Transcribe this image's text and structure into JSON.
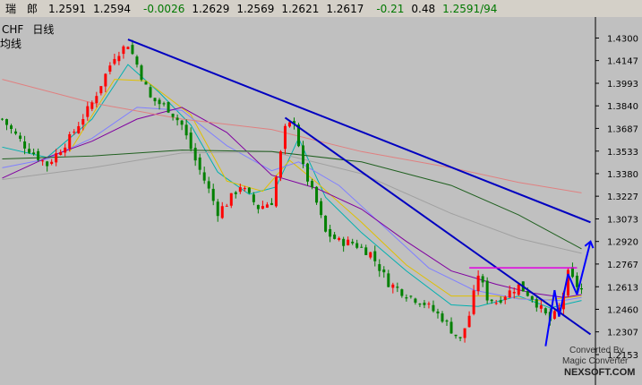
{
  "quote_bar": {
    "name": "瑞　郎",
    "bid": "1.2591",
    "ask": "1.2594",
    "change": "-0.0026",
    "high": "1.2629",
    "low": "1.2569",
    "open": "1.2621",
    "prev": "1.2617",
    "change_pct": "-0.21",
    "amplitude": "0.48",
    "last": "1.2591/94"
  },
  "chart_title": {
    "symbol": "CHF",
    "period": "日线",
    "indicator": "均线"
  },
  "watermark": {
    "line1": "Converted By",
    "line2": "Magic Converter",
    "line3": "NEXSOFT.COM"
  },
  "colors": {
    "background": "#c0c0c0",
    "candle_up": "#ff0000",
    "candle_down": "#008000",
    "ma_fast": "#00b0b0",
    "ma_short": "#e0c000",
    "ma_mid": "#8080ff",
    "ma_purple": "#8000a0",
    "ma_long": "#a0a0a0",
    "ma_dark": "#206020",
    "ma_pink": "#e08080",
    "trendline": "#0000c0",
    "resistance": "#e000e0",
    "arrow": "#0000ff"
  },
  "chart_data": {
    "type": "candlestick",
    "symbol": "CHF",
    "period": "daily",
    "ylim": [
      1.2153,
      1.44
    ],
    "y_ticks": [
      "1.4300",
      "1.4147",
      "1.3993",
      "1.3840",
      "1.3687",
      "1.3533",
      "1.3380",
      "1.3227",
      "1.3073",
      "1.2920",
      "1.2767",
      "1.2613",
      "1.2460",
      "1.2307",
      "1.2153"
    ],
    "bar_count": 130,
    "close_path": [
      [
        0,
        1.375
      ],
      [
        5,
        1.357
      ],
      [
        10,
        1.344
      ],
      [
        15,
        1.362
      ],
      [
        20,
        1.386
      ],
      [
        25,
        1.418
      ],
      [
        28,
        1.426
      ],
      [
        30,
        1.412
      ],
      [
        33,
        1.389
      ],
      [
        37,
        1.382
      ],
      [
        40,
        1.371
      ],
      [
        43,
        1.347
      ],
      [
        46,
        1.327
      ],
      [
        48,
        1.312
      ],
      [
        50,
        1.318
      ],
      [
        53,
        1.33
      ],
      [
        57,
        1.315
      ],
      [
        60,
        1.319
      ],
      [
        63,
        1.368
      ],
      [
        65,
        1.374
      ],
      [
        67,
        1.342
      ],
      [
        70,
        1.318
      ],
      [
        72,
        1.298
      ],
      [
        75,
        1.292
      ],
      [
        78,
        1.291
      ],
      [
        82,
        1.284
      ],
      [
        86,
        1.264
      ],
      [
        90,
        1.256
      ],
      [
        94,
        1.25
      ],
      [
        98,
        1.24
      ],
      [
        100,
        1.232
      ],
      [
        102,
        1.225
      ],
      [
        104,
        1.242
      ],
      [
        106,
        1.27
      ],
      [
        108,
        1.254
      ],
      [
        110,
        1.251
      ],
      [
        112,
        1.256
      ],
      [
        115,
        1.262
      ],
      [
        118,
        1.254
      ],
      [
        120,
        1.246
      ],
      [
        122,
        1.238
      ],
      [
        124,
        1.246
      ],
      [
        126,
        1.27
      ],
      [
        128,
        1.262
      ],
      [
        129,
        1.2591
      ]
    ],
    "moving_averages": [
      {
        "color": "ma_fast",
        "points": [
          [
            0,
            1.356
          ],
          [
            10,
            1.349
          ],
          [
            20,
            1.375
          ],
          [
            28,
            1.412
          ],
          [
            35,
            1.393
          ],
          [
            42,
            1.371
          ],
          [
            48,
            1.339
          ],
          [
            55,
            1.324
          ],
          [
            61,
            1.329
          ],
          [
            66,
            1.362
          ],
          [
            72,
            1.322
          ],
          [
            80,
            1.298
          ],
          [
            90,
            1.272
          ],
          [
            100,
            1.249
          ],
          [
            106,
            1.248
          ],
          [
            115,
            1.255
          ],
          [
            122,
            1.247
          ],
          [
            129,
            1.252
          ]
        ]
      },
      {
        "color": "ma_short",
        "points": [
          [
            15,
            1.353
          ],
          [
            25,
            1.402
          ],
          [
            32,
            1.401
          ],
          [
            42,
            1.378
          ],
          [
            50,
            1.333
          ],
          [
            58,
            1.326
          ],
          [
            64,
            1.347
          ],
          [
            70,
            1.332
          ],
          [
            80,
            1.305
          ],
          [
            90,
            1.276
          ],
          [
            100,
            1.255
          ],
          [
            110,
            1.255
          ],
          [
            120,
            1.252
          ],
          [
            129,
            1.255
          ]
        ]
      },
      {
        "color": "ma_mid",
        "points": [
          [
            0,
            1.342
          ],
          [
            10,
            1.348
          ],
          [
            20,
            1.362
          ],
          [
            30,
            1.383
          ],
          [
            40,
            1.381
          ],
          [
            50,
            1.357
          ],
          [
            60,
            1.34
          ],
          [
            66,
            1.346
          ],
          [
            75,
            1.33
          ],
          [
            85,
            1.302
          ],
          [
            95,
            1.274
          ],
          [
            105,
            1.259
          ],
          [
            115,
            1.253
          ],
          [
            125,
            1.252
          ],
          [
            129,
            1.254
          ]
        ]
      },
      {
        "color": "ma_purple",
        "points": [
          [
            0,
            1.335
          ],
          [
            10,
            1.349
          ],
          [
            20,
            1.36
          ],
          [
            30,
            1.375
          ],
          [
            40,
            1.383
          ],
          [
            50,
            1.366
          ],
          [
            60,
            1.337
          ],
          [
            70,
            1.328
          ],
          [
            80,
            1.314
          ],
          [
            90,
            1.292
          ],
          [
            100,
            1.272
          ],
          [
            110,
            1.263
          ],
          [
            118,
            1.257
          ],
          [
            125,
            1.254
          ],
          [
            129,
            1.256
          ]
        ]
      },
      {
        "color": "ma_long",
        "points": [
          [
            0,
            1.334
          ],
          [
            20,
            1.342
          ],
          [
            40,
            1.352
          ],
          [
            60,
            1.353
          ],
          [
            80,
            1.338
          ],
          [
            100,
            1.311
          ],
          [
            115,
            1.294
          ],
          [
            129,
            1.284
          ]
        ]
      },
      {
        "color": "ma_dark",
        "points": [
          [
            0,
            1.348
          ],
          [
            20,
            1.35
          ],
          [
            40,
            1.354
          ],
          [
            60,
            1.353
          ],
          [
            80,
            1.346
          ],
          [
            100,
            1.33
          ],
          [
            115,
            1.31
          ],
          [
            129,
            1.287
          ]
        ]
      },
      {
        "color": "ma_pink",
        "points": [
          [
            0,
            1.402
          ],
          [
            20,
            1.386
          ],
          [
            40,
            1.375
          ],
          [
            60,
            1.368
          ],
          [
            80,
            1.353
          ],
          [
            100,
            1.342
          ],
          [
            115,
            1.332
          ],
          [
            129,
            1.325
          ]
        ]
      }
    ],
    "trendlines": [
      {
        "color": "trendline",
        "from": [
          28,
          1.429
        ],
        "to": [
          131,
          1.305
        ]
      },
      {
        "color": "trendline",
        "from": [
          63,
          1.376
        ],
        "to": [
          131,
          1.229
        ]
      },
      {
        "color": "resistance",
        "from": [
          104,
          1.2741
        ],
        "to": [
          128,
          1.2741
        ]
      },
      {
        "color": "arrow",
        "from": [
          121,
          1.221
        ],
        "to": [
          123,
          1.259
        ]
      },
      {
        "color": "arrow",
        "from": [
          123,
          1.259
        ],
        "to": [
          124,
          1.241
        ]
      },
      {
        "color": "arrow",
        "from": [
          124,
          1.241
        ],
        "to": [
          126,
          1.27
        ]
      },
      {
        "color": "arrow",
        "from": [
          126,
          1.27
        ],
        "to": [
          128,
          1.256
        ]
      },
      {
        "color": "arrow",
        "from": [
          128,
          1.256
        ],
        "to": [
          131,
          1.292
        ]
      }
    ]
  }
}
